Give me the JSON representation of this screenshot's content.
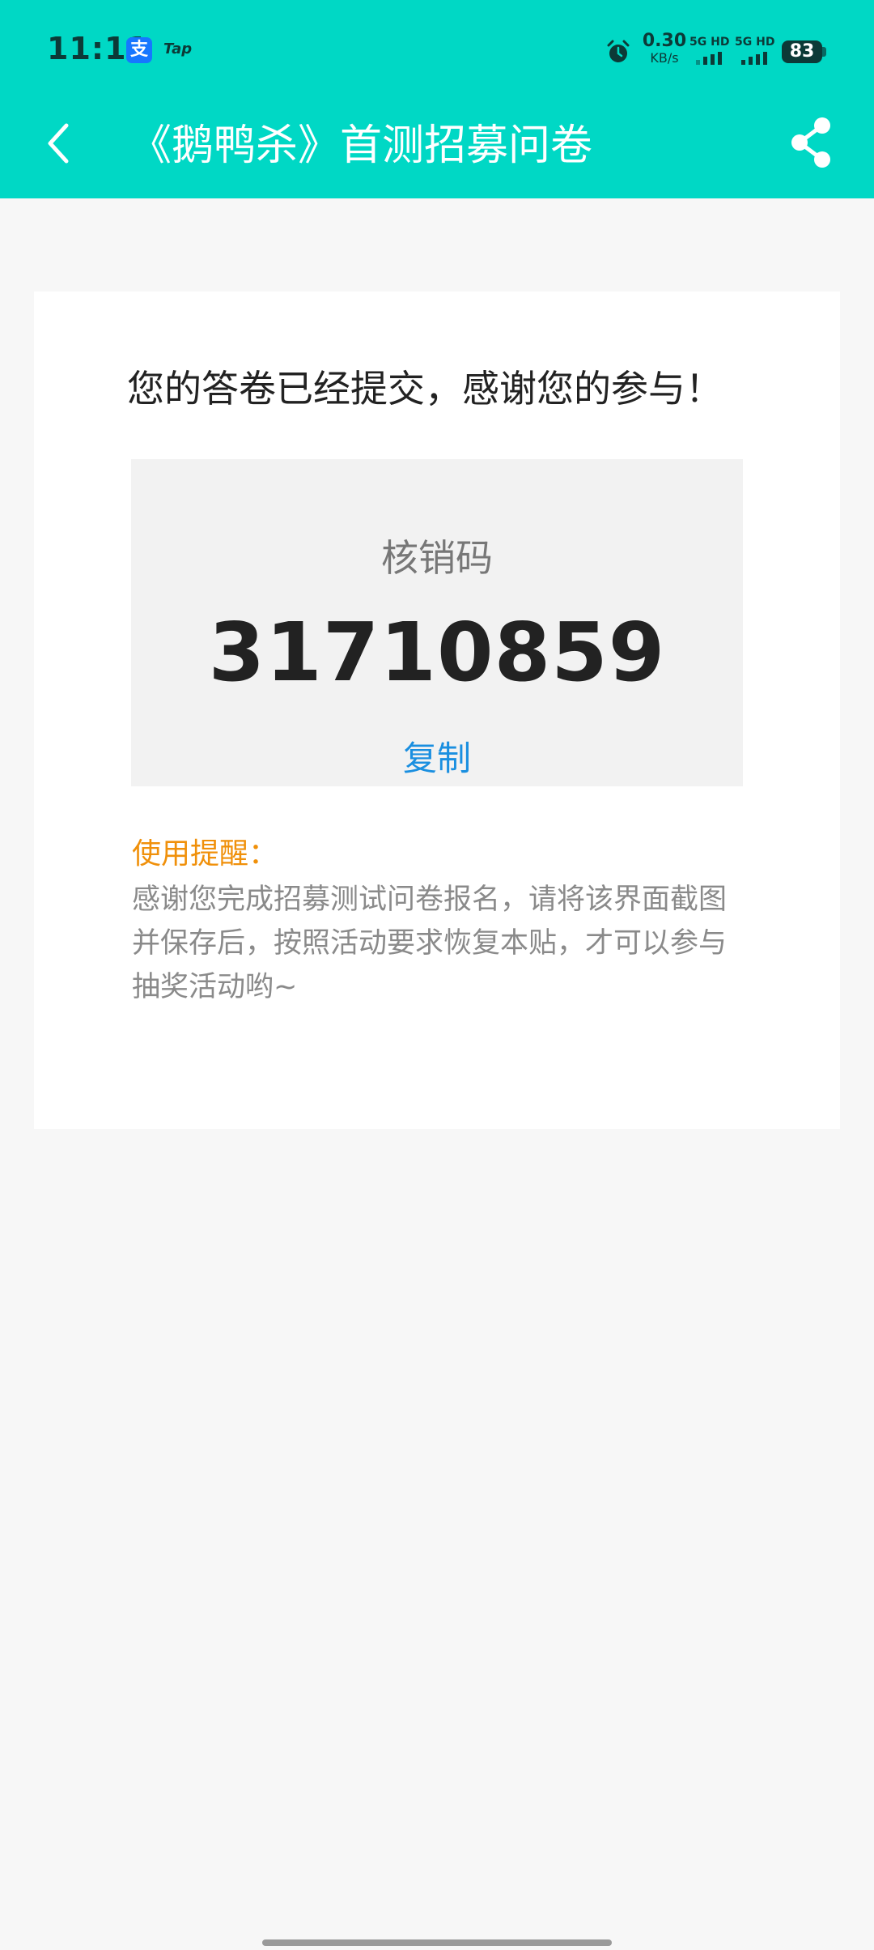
{
  "status_bar": {
    "time": "11:11",
    "alipay_icon_glyph": "支",
    "tap_icon_text": "Tap",
    "net_speed_value": "0.30",
    "net_speed_unit": "KB/s",
    "signal1_label": "5G HD",
    "signal2_label": "5G HD",
    "battery_level": "83"
  },
  "title_bar": {
    "title": "《鹅鸭杀》首测招募问卷",
    "back_icon": "chevron-left-icon",
    "share_icon": "share-icon"
  },
  "content": {
    "thanks_message": "您的答卷已经提交，感谢您的参与！",
    "code_label": "核销码",
    "code_value": "31710859",
    "copy_label": "复制",
    "reminder_title": "使用提醒：",
    "reminder_body": "感谢您完成招募测试问卷报名，请将该界面截图并保存后，按照活动要求恢复本贴，才可以参与抽奖活动哟~"
  },
  "colors": {
    "header_bg": "#00d8c5",
    "page_bg": "#f7f7f7",
    "card_bg": "#ffffff",
    "code_box_bg": "#f2f2f2",
    "copy_link": "#1a8fe0",
    "reminder_title": "#f0900a",
    "reminder_body": "#8a8a8a"
  }
}
